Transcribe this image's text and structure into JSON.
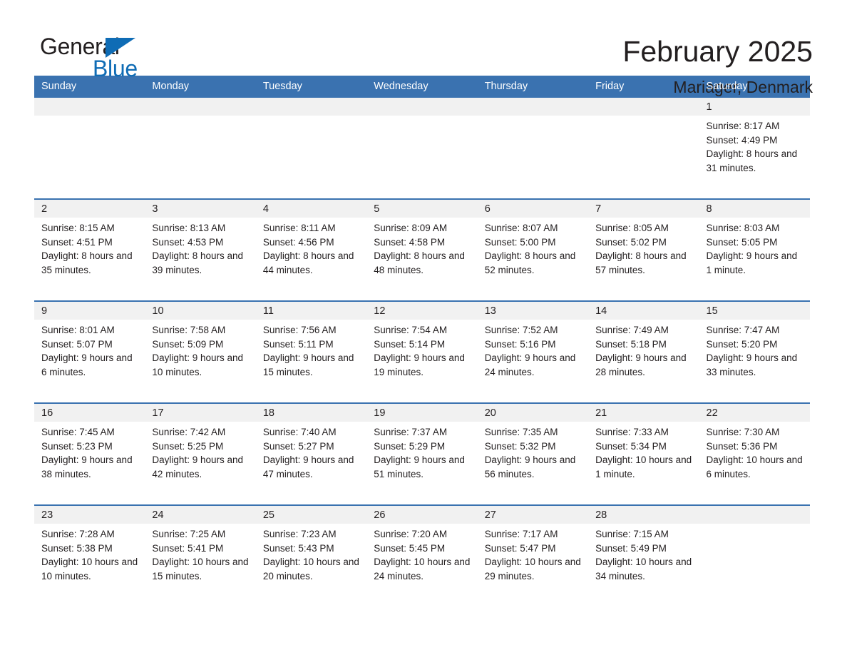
{
  "brand": {
    "name_part1": "General",
    "name_part2": "Blue",
    "accent_color": "#0f6cb5"
  },
  "header": {
    "title": "February 2025",
    "subtitle": "Mariager, Denmark"
  },
  "theme": {
    "header_blue": "#3a72b0",
    "daynum_band": "#f1f1f1",
    "text": "#231f20"
  },
  "weekday_headers": [
    "Sunday",
    "Monday",
    "Tuesday",
    "Wednesday",
    "Thursday",
    "Friday",
    "Saturday"
  ],
  "labels": {
    "sunrise_prefix": "Sunrise:",
    "sunset_prefix": "Sunset:",
    "daylight_prefix": "Daylight:"
  },
  "weeks": [
    [
      {
        "day": "",
        "sunrise": "",
        "sunset": "",
        "daylight": "",
        "empty": true
      },
      {
        "day": "",
        "sunrise": "",
        "sunset": "",
        "daylight": "",
        "empty": true
      },
      {
        "day": "",
        "sunrise": "",
        "sunset": "",
        "daylight": "",
        "empty": true
      },
      {
        "day": "",
        "sunrise": "",
        "sunset": "",
        "daylight": "",
        "empty": true
      },
      {
        "day": "",
        "sunrise": "",
        "sunset": "",
        "daylight": "",
        "empty": true
      },
      {
        "day": "",
        "sunrise": "",
        "sunset": "",
        "daylight": "",
        "empty": true
      },
      {
        "day": "1",
        "sunrise": "Sunrise: 8:17 AM",
        "sunset": "Sunset: 4:49 PM",
        "daylight": "Daylight: 8 hours and 31 minutes.",
        "empty": false
      }
    ],
    [
      {
        "day": "2",
        "sunrise": "Sunrise: 8:15 AM",
        "sunset": "Sunset: 4:51 PM",
        "daylight": "Daylight: 8 hours and 35 minutes.",
        "empty": false
      },
      {
        "day": "3",
        "sunrise": "Sunrise: 8:13 AM",
        "sunset": "Sunset: 4:53 PM",
        "daylight": "Daylight: 8 hours and 39 minutes.",
        "empty": false
      },
      {
        "day": "4",
        "sunrise": "Sunrise: 8:11 AM",
        "sunset": "Sunset: 4:56 PM",
        "daylight": "Daylight: 8 hours and 44 minutes.",
        "empty": false
      },
      {
        "day": "5",
        "sunrise": "Sunrise: 8:09 AM",
        "sunset": "Sunset: 4:58 PM",
        "daylight": "Daylight: 8 hours and 48 minutes.",
        "empty": false
      },
      {
        "day": "6",
        "sunrise": "Sunrise: 8:07 AM",
        "sunset": "Sunset: 5:00 PM",
        "daylight": "Daylight: 8 hours and 52 minutes.",
        "empty": false
      },
      {
        "day": "7",
        "sunrise": "Sunrise: 8:05 AM",
        "sunset": "Sunset: 5:02 PM",
        "daylight": "Daylight: 8 hours and 57 minutes.",
        "empty": false
      },
      {
        "day": "8",
        "sunrise": "Sunrise: 8:03 AM",
        "sunset": "Sunset: 5:05 PM",
        "daylight": "Daylight: 9 hours and 1 minute.",
        "empty": false
      }
    ],
    [
      {
        "day": "9",
        "sunrise": "Sunrise: 8:01 AM",
        "sunset": "Sunset: 5:07 PM",
        "daylight": "Daylight: 9 hours and 6 minutes.",
        "empty": false
      },
      {
        "day": "10",
        "sunrise": "Sunrise: 7:58 AM",
        "sunset": "Sunset: 5:09 PM",
        "daylight": "Daylight: 9 hours and 10 minutes.",
        "empty": false
      },
      {
        "day": "11",
        "sunrise": "Sunrise: 7:56 AM",
        "sunset": "Sunset: 5:11 PM",
        "daylight": "Daylight: 9 hours and 15 minutes.",
        "empty": false
      },
      {
        "day": "12",
        "sunrise": "Sunrise: 7:54 AM",
        "sunset": "Sunset: 5:14 PM",
        "daylight": "Daylight: 9 hours and 19 minutes.",
        "empty": false
      },
      {
        "day": "13",
        "sunrise": "Sunrise: 7:52 AM",
        "sunset": "Sunset: 5:16 PM",
        "daylight": "Daylight: 9 hours and 24 minutes.",
        "empty": false
      },
      {
        "day": "14",
        "sunrise": "Sunrise: 7:49 AM",
        "sunset": "Sunset: 5:18 PM",
        "daylight": "Daylight: 9 hours and 28 minutes.",
        "empty": false
      },
      {
        "day": "15",
        "sunrise": "Sunrise: 7:47 AM",
        "sunset": "Sunset: 5:20 PM",
        "daylight": "Daylight: 9 hours and 33 minutes.",
        "empty": false
      }
    ],
    [
      {
        "day": "16",
        "sunrise": "Sunrise: 7:45 AM",
        "sunset": "Sunset: 5:23 PM",
        "daylight": "Daylight: 9 hours and 38 minutes.",
        "empty": false
      },
      {
        "day": "17",
        "sunrise": "Sunrise: 7:42 AM",
        "sunset": "Sunset: 5:25 PM",
        "daylight": "Daylight: 9 hours and 42 minutes.",
        "empty": false
      },
      {
        "day": "18",
        "sunrise": "Sunrise: 7:40 AM",
        "sunset": "Sunset: 5:27 PM",
        "daylight": "Daylight: 9 hours and 47 minutes.",
        "empty": false
      },
      {
        "day": "19",
        "sunrise": "Sunrise: 7:37 AM",
        "sunset": "Sunset: 5:29 PM",
        "daylight": "Daylight: 9 hours and 51 minutes.",
        "empty": false
      },
      {
        "day": "20",
        "sunrise": "Sunrise: 7:35 AM",
        "sunset": "Sunset: 5:32 PM",
        "daylight": "Daylight: 9 hours and 56 minutes.",
        "empty": false
      },
      {
        "day": "21",
        "sunrise": "Sunrise: 7:33 AM",
        "sunset": "Sunset: 5:34 PM",
        "daylight": "Daylight: 10 hours and 1 minute.",
        "empty": false
      },
      {
        "day": "22",
        "sunrise": "Sunrise: 7:30 AM",
        "sunset": "Sunset: 5:36 PM",
        "daylight": "Daylight: 10 hours and 6 minutes.",
        "empty": false
      }
    ],
    [
      {
        "day": "23",
        "sunrise": "Sunrise: 7:28 AM",
        "sunset": "Sunset: 5:38 PM",
        "daylight": "Daylight: 10 hours and 10 minutes.",
        "empty": false
      },
      {
        "day": "24",
        "sunrise": "Sunrise: 7:25 AM",
        "sunset": "Sunset: 5:41 PM",
        "daylight": "Daylight: 10 hours and 15 minutes.",
        "empty": false
      },
      {
        "day": "25",
        "sunrise": "Sunrise: 7:23 AM",
        "sunset": "Sunset: 5:43 PM",
        "daylight": "Daylight: 10 hours and 20 minutes.",
        "empty": false
      },
      {
        "day": "26",
        "sunrise": "Sunrise: 7:20 AM",
        "sunset": "Sunset: 5:45 PM",
        "daylight": "Daylight: 10 hours and 24 minutes.",
        "empty": false
      },
      {
        "day": "27",
        "sunrise": "Sunrise: 7:17 AM",
        "sunset": "Sunset: 5:47 PM",
        "daylight": "Daylight: 10 hours and 29 minutes.",
        "empty": false
      },
      {
        "day": "28",
        "sunrise": "Sunrise: 7:15 AM",
        "sunset": "Sunset: 5:49 PM",
        "daylight": "Daylight: 10 hours and 34 minutes.",
        "empty": false
      },
      {
        "day": "",
        "sunrise": "",
        "sunset": "",
        "daylight": "",
        "empty": true
      }
    ]
  ]
}
